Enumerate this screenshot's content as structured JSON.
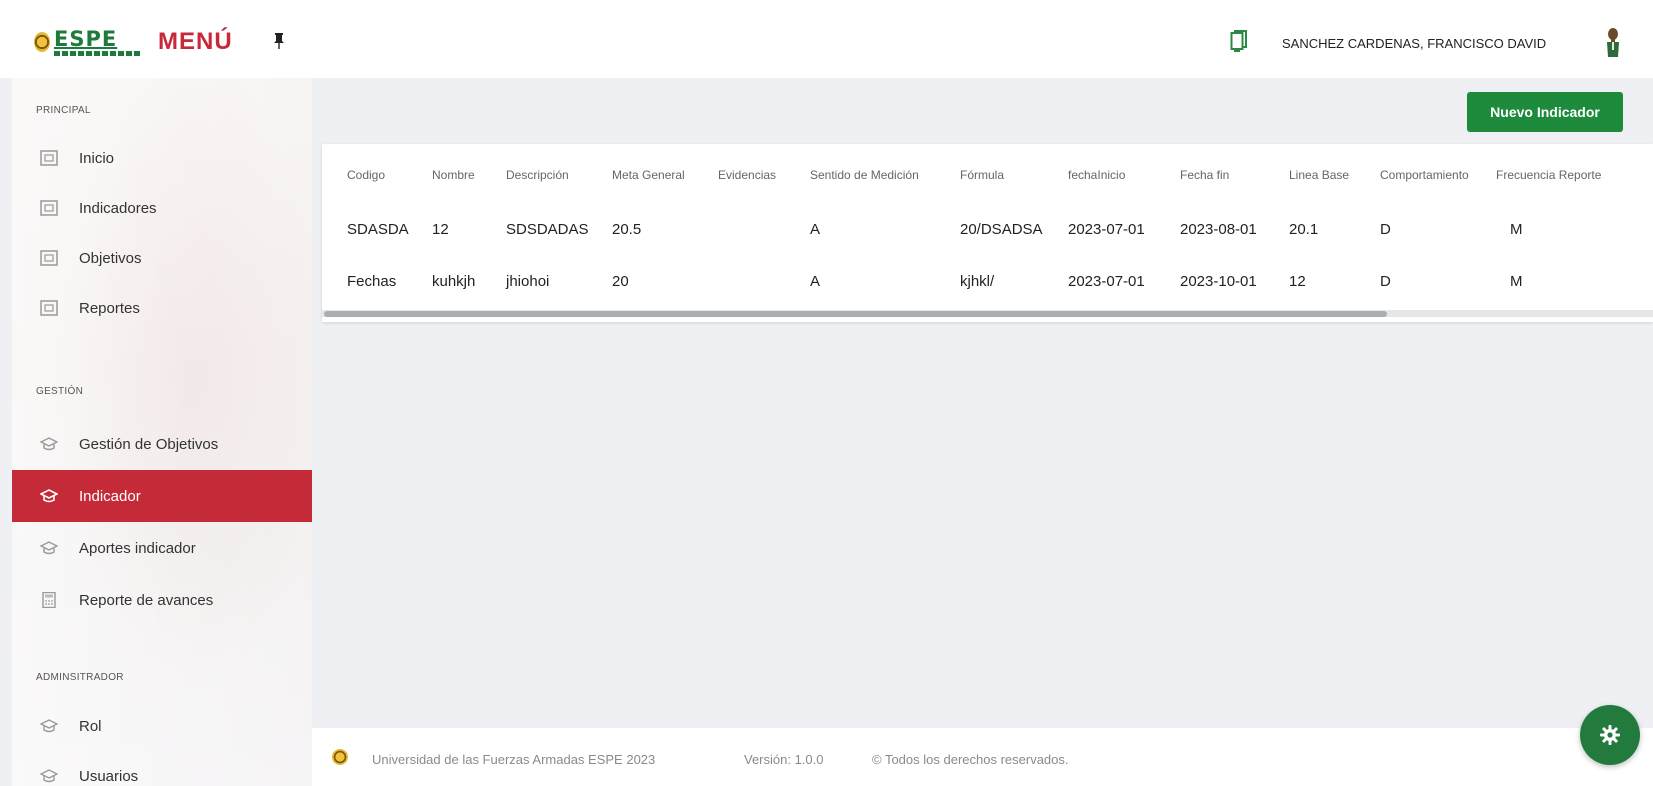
{
  "header": {
    "logo_text": "ESPE",
    "menu_title": "MENÚ",
    "user_name": "SANCHEZ CARDENAS, FRANCISCO DAVID"
  },
  "sidebar": {
    "sections": [
      {
        "label": "PRINCIPAL"
      },
      {
        "label": "GESTIÓN"
      },
      {
        "label": "ADMINSITRADOR"
      }
    ],
    "items": [
      {
        "label": "Inicio",
        "icon": "image-frame-icon"
      },
      {
        "label": "Indicadores",
        "icon": "image-frame-icon"
      },
      {
        "label": "Objetivos",
        "icon": "image-frame-icon"
      },
      {
        "label": "Reportes",
        "icon": "image-frame-icon"
      },
      {
        "label": "Gestión de Objetivos",
        "icon": "graduation-cap-icon"
      },
      {
        "label": "Indicador",
        "icon": "graduation-cap-icon",
        "active": true
      },
      {
        "label": "Aportes indicador",
        "icon": "graduation-cap-icon"
      },
      {
        "label": "Reporte de avances",
        "icon": "calculator-icon"
      },
      {
        "label": "Rol",
        "icon": "graduation-cap-icon"
      },
      {
        "label": "Usuarios",
        "icon": "graduation-cap-icon"
      }
    ]
  },
  "toolbar": {
    "new_button_label": "Nuevo Indicador"
  },
  "table": {
    "columns": [
      "Codigo",
      "Nombre",
      "Descripción",
      "Meta General",
      "Evidencias",
      "Sentido de Medición",
      "Fórmula",
      "fechaInicio",
      "Fecha fin",
      "Linea Base",
      "Comportamiento",
      "Frecuencia Reporte"
    ],
    "rows": [
      [
        "SDASDA",
        "12",
        "SDSDADAS",
        "20.5",
        "",
        "A",
        "20/DSADSA",
        "2023-07-01",
        "2023-08-01",
        "20.1",
        "D",
        "M"
      ],
      [
        "Fechas",
        "kuhkjh",
        "jhiohoi",
        "20",
        "",
        "A",
        "kjhkl/",
        "2023-07-01",
        "2023-10-01",
        "12",
        "D",
        "M"
      ]
    ]
  },
  "footer": {
    "university": "Universidad de las Fuerzas Armadas ESPE 2023",
    "version": "Versión: 1.0.0",
    "rights": "© Todos los derechos reservados."
  },
  "colors": {
    "brand_green": "#1e8a3c",
    "brand_red": "#c42a38"
  }
}
